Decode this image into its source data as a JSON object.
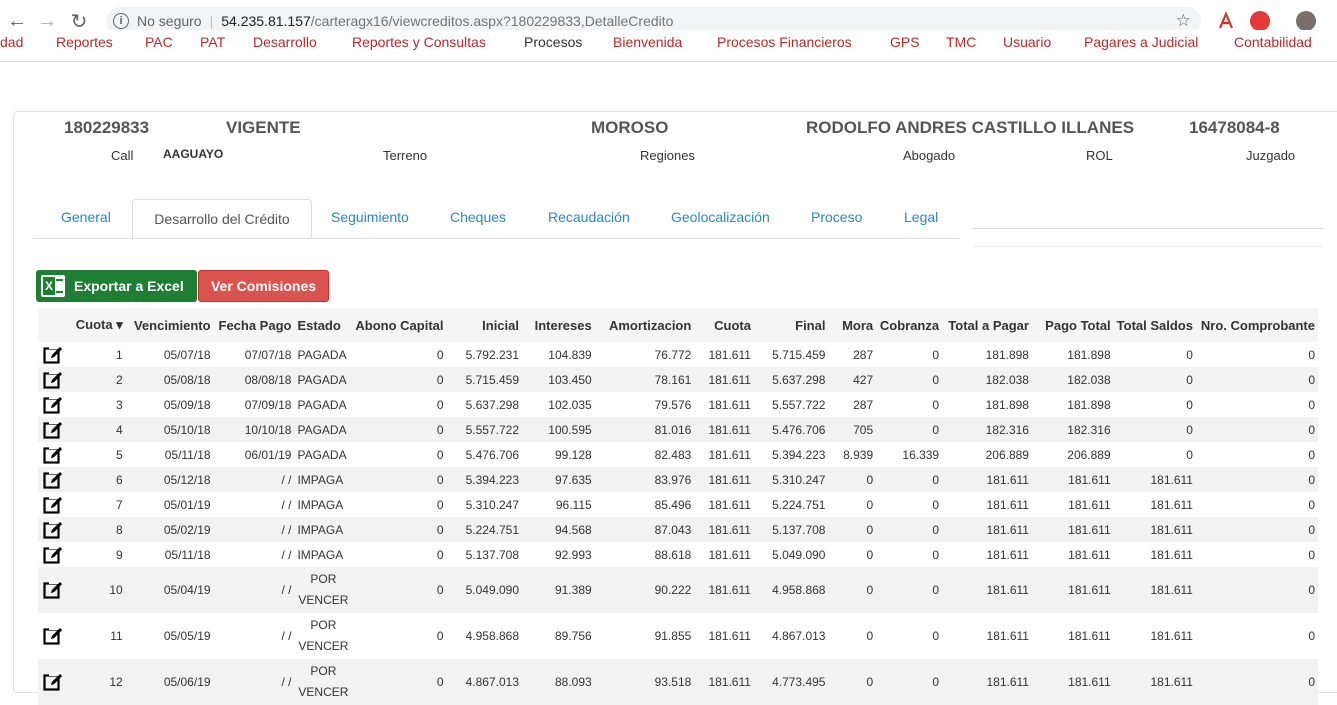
{
  "browser": {
    "security": "No seguro",
    "host": "54.235.81.157",
    "path": "/carteragx16/viewcreditos.aspx?180229833,DetalleCredito"
  },
  "menu": [
    "dad",
    "Reportes",
    "PAC",
    "PAT",
    "Desarrollo",
    "Reportes y Consultas",
    "Procesos",
    "Bienvenida",
    "Procesos Financieros",
    "GPS",
    "TMC",
    "Usuario",
    "Pagares a Judicial",
    "Contabilidad"
  ],
  "credit": {
    "id": "180229833",
    "status": "VIGENTE",
    "moroso": "MOROSO",
    "client": "RODOLFO ANDRES CASTILLO ILLANES",
    "rut": "16478084-8",
    "call_label": "Call",
    "call_value": "AAGUAYO",
    "terreno": "Terreno",
    "regiones": "Regiones",
    "abogado": "Abogado",
    "rol": "ROL",
    "juzgado": "Juzgado"
  },
  "tabs": [
    "General",
    "Desarrollo del Crédito",
    "Seguimiento",
    "Cheques",
    "Recaudación",
    "Geolocalización",
    "Proceso",
    "Legal"
  ],
  "buttons": {
    "excel": "Exportar a Excel",
    "comisiones": "Ver Comisiones"
  },
  "table": {
    "headers": [
      "Cuota ▾",
      "Vencimiento",
      "Fecha Pago",
      "Estado",
      "Abono Capital",
      "Inicial",
      "Intereses",
      "Amortizacion",
      "Cuota",
      "Final",
      "Mora",
      "Cobranza",
      "Total a Pagar",
      "Pago Total",
      "Total Saldos",
      "Nro. Comprobante"
    ],
    "rows": [
      [
        "1",
        "05/07/18",
        "07/07/18",
        "PAGADA",
        "0",
        "5.792.231",
        "104.839",
        "76.772",
        "181.611",
        "5.715.459",
        "287",
        "0",
        "181.898",
        "181.898",
        "0",
        "0"
      ],
      [
        "2",
        "05/08/18",
        "08/08/18",
        "PAGADA",
        "0",
        "5.715.459",
        "103.450",
        "78.161",
        "181.611",
        "5.637.298",
        "427",
        "0",
        "182.038",
        "182.038",
        "0",
        "0"
      ],
      [
        "3",
        "05/09/18",
        "07/09/18",
        "PAGADA",
        "0",
        "5.637.298",
        "102.035",
        "79.576",
        "181.611",
        "5.557.722",
        "287",
        "0",
        "181.898",
        "181.898",
        "0",
        "0"
      ],
      [
        "4",
        "05/10/18",
        "10/10/18",
        "PAGADA",
        "0",
        "5.557.722",
        "100.595",
        "81.016",
        "181.611",
        "5.476.706",
        "705",
        "0",
        "182.316",
        "182.316",
        "0",
        "0"
      ],
      [
        "5",
        "05/11/18",
        "06/01/19",
        "PAGADA",
        "0",
        "5.476.706",
        "99.128",
        "82.483",
        "181.611",
        "5.394.223",
        "8.939",
        "16.339",
        "206.889",
        "206.889",
        "0",
        "0"
      ],
      [
        "6",
        "05/12/18",
        "/ /",
        "IMPAGA",
        "0",
        "5.394.223",
        "97.635",
        "83.976",
        "181.611",
        "5.310.247",
        "0",
        "0",
        "181.611",
        "181.611",
        "181.611",
        "0"
      ],
      [
        "7",
        "05/01/19",
        "/ /",
        "IMPAGA",
        "0",
        "5.310.247",
        "96.115",
        "85.496",
        "181.611",
        "5.224.751",
        "0",
        "0",
        "181.611",
        "181.611",
        "181.611",
        "0"
      ],
      [
        "8",
        "05/02/19",
        "/ /",
        "IMPAGA",
        "0",
        "5.224.751",
        "94.568",
        "87.043",
        "181.611",
        "5.137.708",
        "0",
        "0",
        "181.611",
        "181.611",
        "181.611",
        "0"
      ],
      [
        "9",
        "05/11/18",
        "/ /",
        "IMPAGA",
        "0",
        "5.137.708",
        "92.993",
        "88.618",
        "181.611",
        "5.049.090",
        "0",
        "0",
        "181.611",
        "181.611",
        "181.611",
        "0"
      ],
      [
        "10",
        "05/04/19",
        "/ /",
        "POR VENCER",
        "0",
        "5.049.090",
        "91.389",
        "90.222",
        "181.611",
        "4.958.868",
        "0",
        "0",
        "181.611",
        "181.611",
        "181.611",
        "0"
      ],
      [
        "11",
        "05/05/19",
        "/ /",
        "POR VENCER",
        "0",
        "4.958.868",
        "89.756",
        "91.855",
        "181.611",
        "4.867.013",
        "0",
        "0",
        "181.611",
        "181.611",
        "181.611",
        "0"
      ],
      [
        "12",
        "05/06/19",
        "/ /",
        "POR VENCER",
        "0",
        "4.867.013",
        "88.093",
        "93.518",
        "181.611",
        "4.773.495",
        "0",
        "0",
        "181.611",
        "181.611",
        "181.611",
        "0"
      ]
    ]
  }
}
